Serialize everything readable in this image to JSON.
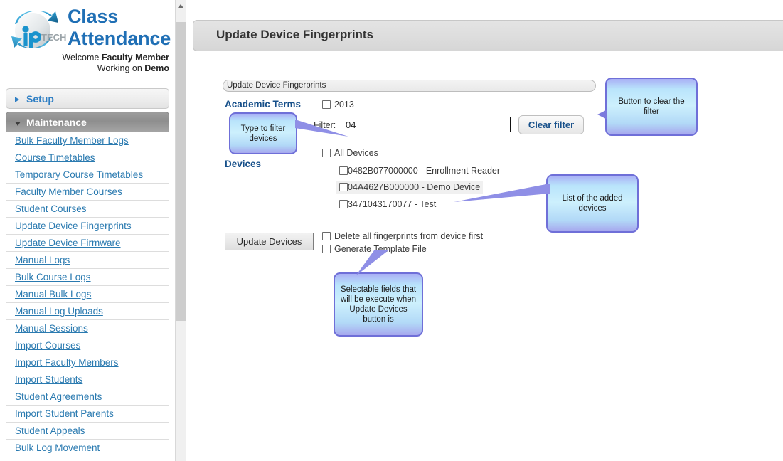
{
  "brand": {
    "logo_icon": "iptech-globe-logo",
    "title_line1": "Class",
    "title_line2": "Attendance",
    "welcome_prefix": "Welcome ",
    "welcome_user": "Faculty Member",
    "working_prefix": "Working on ",
    "working_target": "Demo"
  },
  "sidebar": {
    "sections": [
      {
        "label": "Setup",
        "expanded": false,
        "icon": "chevron-right-icon"
      },
      {
        "label": "Maintenance",
        "expanded": true,
        "icon": "chevron-down-icon"
      }
    ],
    "items": [
      {
        "label": "Bulk Faculty Member Logs"
      },
      {
        "label": "Course Timetables"
      },
      {
        "label": "Temporary Course Timetables"
      },
      {
        "label": "Faculty Member Courses"
      },
      {
        "label": "Student Courses"
      },
      {
        "label": "Update Device Fingerprints"
      },
      {
        "label": "Update Device Firmware"
      },
      {
        "label": "Manual Logs"
      },
      {
        "label": "Bulk Course Logs"
      },
      {
        "label": "Manual Bulk Logs"
      },
      {
        "label": "Manual Log Uploads"
      },
      {
        "label": "Manual Sessions"
      },
      {
        "label": "Import Courses"
      },
      {
        "label": "Import Faculty Members"
      },
      {
        "label": "Import Students"
      },
      {
        "label": "Student Agreements"
      },
      {
        "label": "Import Student Parents"
      },
      {
        "label": "Student Appeals"
      },
      {
        "label": "Bulk Log Movement"
      }
    ]
  },
  "scrollbar": {
    "up_icon": "chevron-up-icon"
  },
  "header": {
    "title": "Update Device Fingerprints"
  },
  "form": {
    "legend": "Update Device Fingerprints",
    "academic_terms_label": "Academic Terms",
    "terms": [
      {
        "label": "2013",
        "checked": false
      }
    ],
    "filter_label": "Filter:",
    "filter_value": "04",
    "filter_placeholder": "",
    "clear_filter_label": "Clear filter",
    "devices_label": "Devices",
    "all_devices_label": "All Devices",
    "all_devices_checked": false,
    "devices": [
      {
        "label": "0482B077000000 - Enrollment Reader",
        "checked": false,
        "highlighted": false
      },
      {
        "label": "04A4627B000000 - Demo Device",
        "checked": false,
        "highlighted": true
      },
      {
        "label": "3471043170077 - Test",
        "checked": false,
        "highlighted": false
      }
    ],
    "update_button_label": "Update Devices",
    "options": [
      {
        "label": "Delete all fingerprints from device first",
        "checked": false
      },
      {
        "label": "Generate Template File",
        "checked": false
      }
    ]
  },
  "callouts": {
    "clear_filter": "Button to clear the filter",
    "type_filter": "Type to filter devices",
    "device_list": "List of the added devices",
    "selectable_fields": "Selectable fields that will be execute when Update Devices button is"
  },
  "colors": {
    "brand_blue": "#1f6fb5",
    "link_blue": "#2a7ab0",
    "section_label_blue": "#17508a",
    "callout_border": "#6f6fd8",
    "callout_fill": "#bfe6fb",
    "active_section_bg": "#9d9d9d"
  }
}
